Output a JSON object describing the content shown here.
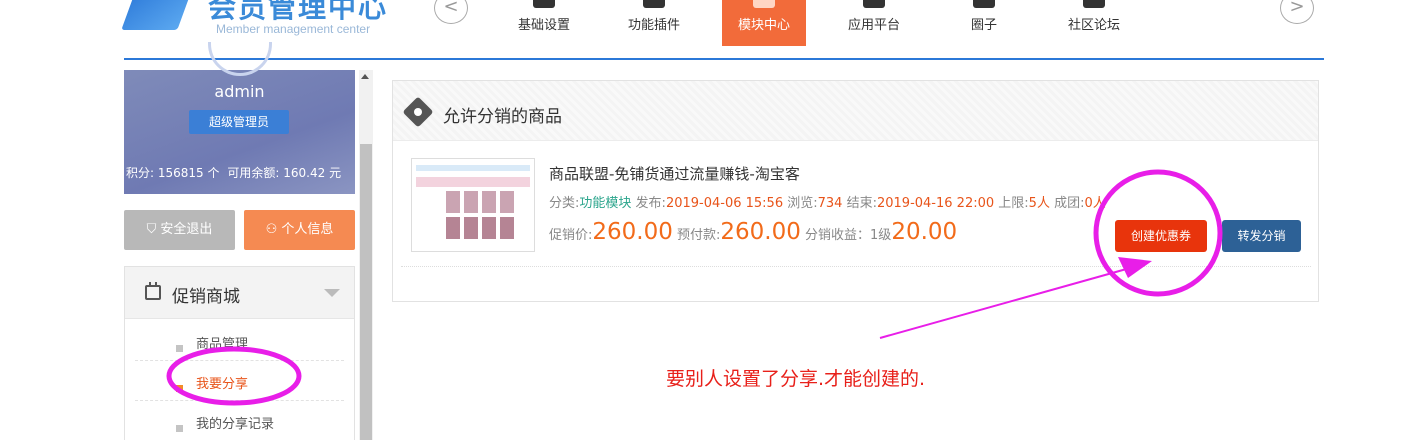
{
  "header": {
    "logo_title": "会员管理中心",
    "logo_subtitle": "Member management center",
    "prev_arrow": "<",
    "next_arrow": ">",
    "nav": [
      {
        "label": "基础设置"
      },
      {
        "label": "功能插件"
      },
      {
        "label": "模块中心",
        "active": true
      },
      {
        "label": "应用平台"
      },
      {
        "label": "圈子"
      },
      {
        "label": "社区论坛"
      }
    ],
    "accent_color": "#2b78d8",
    "active_color": "#f26b3a"
  },
  "sidebar": {
    "username": "admin",
    "role": "超级管理员",
    "points_label": "积分:",
    "points_value": "156815",
    "points_unit": "个",
    "balance_label": "可用余额:",
    "balance_value": "160.42",
    "balance_unit": "元",
    "logout_label": "安全退出",
    "profile_label": "个人信息",
    "menu_title": "促销商城",
    "menu_items": [
      {
        "label": "商品管理"
      },
      {
        "label": "我要分享",
        "active": true
      },
      {
        "label": "我的分享记录"
      }
    ]
  },
  "panel": {
    "title": "允许分销的商品",
    "product": {
      "title": "商品联盟-免铺货通过流量赚钱-淘宝客",
      "category_label": "分类:",
      "category_value": "功能模块",
      "publish_label": "发布:",
      "publish_value": "2019-04-06 15:56",
      "views_label": "浏览:",
      "views_value": "734",
      "end_label": "结束:",
      "end_value": "2019-04-16 22:00",
      "limit_label": "上限:",
      "limit_value": "5人",
      "group_label": "成团:",
      "group_value": "0人",
      "promo_label": "促销价:",
      "promo_value": "260.00",
      "prepay_label": "预付款:",
      "prepay_value": "260.00",
      "commission_label": "分销收益：1级",
      "commission_value": "20.00"
    },
    "coupon_button": "创建优惠券",
    "forward_button": "转发分销"
  },
  "annotation": {
    "text": "要别人设置了分享.才能创建的.",
    "color": "#e81ee8"
  }
}
